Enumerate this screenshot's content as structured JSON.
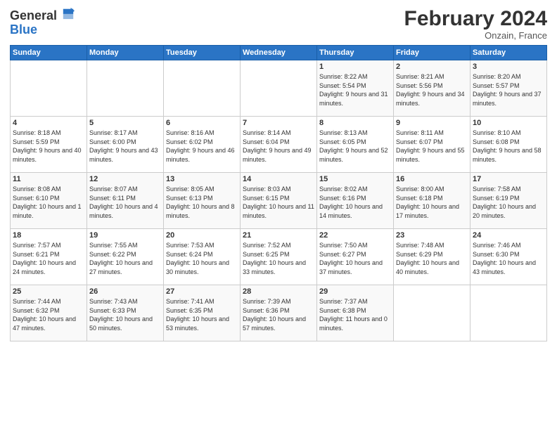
{
  "header": {
    "logo_line1": "General",
    "logo_line2": "Blue",
    "month_title": "February 2024",
    "location": "Onzain, France"
  },
  "weekdays": [
    "Sunday",
    "Monday",
    "Tuesday",
    "Wednesday",
    "Thursday",
    "Friday",
    "Saturday"
  ],
  "weeks": [
    [
      {
        "day": "",
        "info": ""
      },
      {
        "day": "",
        "info": ""
      },
      {
        "day": "",
        "info": ""
      },
      {
        "day": "",
        "info": ""
      },
      {
        "day": "1",
        "info": "Sunrise: 8:22 AM\nSunset: 5:54 PM\nDaylight: 9 hours and 31 minutes."
      },
      {
        "day": "2",
        "info": "Sunrise: 8:21 AM\nSunset: 5:56 PM\nDaylight: 9 hours and 34 minutes."
      },
      {
        "day": "3",
        "info": "Sunrise: 8:20 AM\nSunset: 5:57 PM\nDaylight: 9 hours and 37 minutes."
      }
    ],
    [
      {
        "day": "4",
        "info": "Sunrise: 8:18 AM\nSunset: 5:59 PM\nDaylight: 9 hours and 40 minutes."
      },
      {
        "day": "5",
        "info": "Sunrise: 8:17 AM\nSunset: 6:00 PM\nDaylight: 9 hours and 43 minutes."
      },
      {
        "day": "6",
        "info": "Sunrise: 8:16 AM\nSunset: 6:02 PM\nDaylight: 9 hours and 46 minutes."
      },
      {
        "day": "7",
        "info": "Sunrise: 8:14 AM\nSunset: 6:04 PM\nDaylight: 9 hours and 49 minutes."
      },
      {
        "day": "8",
        "info": "Sunrise: 8:13 AM\nSunset: 6:05 PM\nDaylight: 9 hours and 52 minutes."
      },
      {
        "day": "9",
        "info": "Sunrise: 8:11 AM\nSunset: 6:07 PM\nDaylight: 9 hours and 55 minutes."
      },
      {
        "day": "10",
        "info": "Sunrise: 8:10 AM\nSunset: 6:08 PM\nDaylight: 9 hours and 58 minutes."
      }
    ],
    [
      {
        "day": "11",
        "info": "Sunrise: 8:08 AM\nSunset: 6:10 PM\nDaylight: 10 hours and 1 minute."
      },
      {
        "day": "12",
        "info": "Sunrise: 8:07 AM\nSunset: 6:11 PM\nDaylight: 10 hours and 4 minutes."
      },
      {
        "day": "13",
        "info": "Sunrise: 8:05 AM\nSunset: 6:13 PM\nDaylight: 10 hours and 8 minutes."
      },
      {
        "day": "14",
        "info": "Sunrise: 8:03 AM\nSunset: 6:15 PM\nDaylight: 10 hours and 11 minutes."
      },
      {
        "day": "15",
        "info": "Sunrise: 8:02 AM\nSunset: 6:16 PM\nDaylight: 10 hours and 14 minutes."
      },
      {
        "day": "16",
        "info": "Sunrise: 8:00 AM\nSunset: 6:18 PM\nDaylight: 10 hours and 17 minutes."
      },
      {
        "day": "17",
        "info": "Sunrise: 7:58 AM\nSunset: 6:19 PM\nDaylight: 10 hours and 20 minutes."
      }
    ],
    [
      {
        "day": "18",
        "info": "Sunrise: 7:57 AM\nSunset: 6:21 PM\nDaylight: 10 hours and 24 minutes."
      },
      {
        "day": "19",
        "info": "Sunrise: 7:55 AM\nSunset: 6:22 PM\nDaylight: 10 hours and 27 minutes."
      },
      {
        "day": "20",
        "info": "Sunrise: 7:53 AM\nSunset: 6:24 PM\nDaylight: 10 hours and 30 minutes."
      },
      {
        "day": "21",
        "info": "Sunrise: 7:52 AM\nSunset: 6:25 PM\nDaylight: 10 hours and 33 minutes."
      },
      {
        "day": "22",
        "info": "Sunrise: 7:50 AM\nSunset: 6:27 PM\nDaylight: 10 hours and 37 minutes."
      },
      {
        "day": "23",
        "info": "Sunrise: 7:48 AM\nSunset: 6:29 PM\nDaylight: 10 hours and 40 minutes."
      },
      {
        "day": "24",
        "info": "Sunrise: 7:46 AM\nSunset: 6:30 PM\nDaylight: 10 hours and 43 minutes."
      }
    ],
    [
      {
        "day": "25",
        "info": "Sunrise: 7:44 AM\nSunset: 6:32 PM\nDaylight: 10 hours and 47 minutes."
      },
      {
        "day": "26",
        "info": "Sunrise: 7:43 AM\nSunset: 6:33 PM\nDaylight: 10 hours and 50 minutes."
      },
      {
        "day": "27",
        "info": "Sunrise: 7:41 AM\nSunset: 6:35 PM\nDaylight: 10 hours and 53 minutes."
      },
      {
        "day": "28",
        "info": "Sunrise: 7:39 AM\nSunset: 6:36 PM\nDaylight: 10 hours and 57 minutes."
      },
      {
        "day": "29",
        "info": "Sunrise: 7:37 AM\nSunset: 6:38 PM\nDaylight: 11 hours and 0 minutes."
      },
      {
        "day": "",
        "info": ""
      },
      {
        "day": "",
        "info": ""
      }
    ]
  ]
}
